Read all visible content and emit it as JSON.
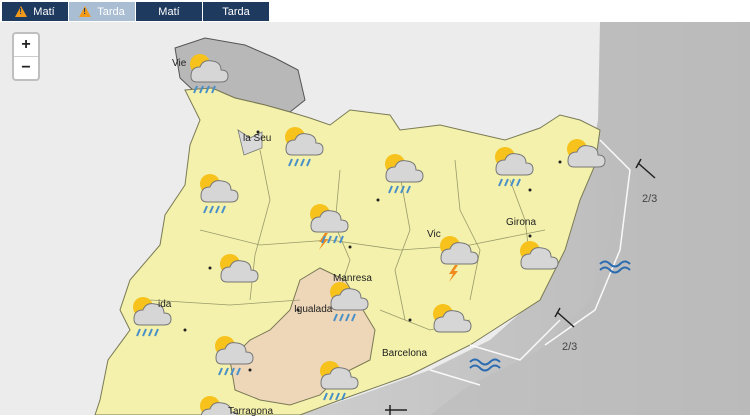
{
  "tabs": [
    {
      "label": "Matí",
      "warning": true
    },
    {
      "label": "Tarda",
      "warning": true,
      "active": true
    },
    {
      "label": "Matí",
      "warning": false
    },
    {
      "label": "Tarda",
      "warning": false
    }
  ],
  "zoom": {
    "in": "+",
    "out": "−"
  },
  "places": [
    "Vie",
    "la Seu",
    "Girona",
    "Vic",
    "Manresa",
    "ida",
    "Igualada",
    "Barcelona",
    "Tarragona"
  ],
  "sea_state": [
    "2/3",
    "2/3"
  ],
  "icon_types": [
    "sun-cloud-rain",
    "sun-cloud-storm",
    "sun-cloud"
  ],
  "colors": {
    "warning_yellow": "#f3f1ab",
    "warning_orange": "#eed6b8",
    "tab_dark": "#1f3a5f",
    "tab_active": "#a9bdd3",
    "warning_icon": "#f39a1b"
  }
}
